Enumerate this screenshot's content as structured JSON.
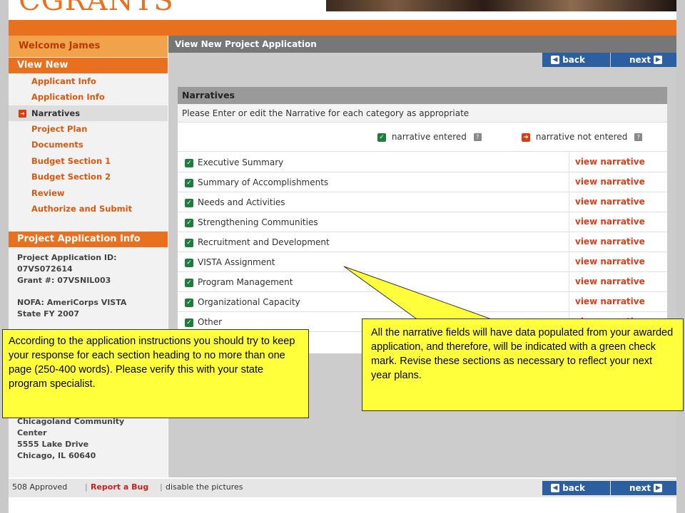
{
  "brand": {
    "logo_text": "CGRANTS",
    "accent": "#e8701f"
  },
  "sidebar": {
    "welcome": "Welcome James",
    "section": "View New",
    "items": [
      {
        "label": "Applicant Info"
      },
      {
        "label": "Application Info"
      },
      {
        "label": "Narratives",
        "active": true
      },
      {
        "label": "Project Plan"
      },
      {
        "label": "Documents"
      },
      {
        "label": "Budget Section 1"
      },
      {
        "label": "Budget Section 2"
      },
      {
        "label": "Review"
      },
      {
        "label": "Authorize and Submit"
      }
    ],
    "info_title": "Project Application Info",
    "info_lines": [
      "Project Application ID:",
      "07VS072614",
      "Grant #: 07VSNIL003",
      "NOFA: AmeriCorps VISTA",
      "State FY 2007"
    ],
    "org_lines": [
      "Chicagoland Community",
      "Center",
      "5555 Lake Drive",
      "Chicago, IL 60640"
    ]
  },
  "main": {
    "title": "View New Project Application",
    "back_label": "back",
    "next_label": "next",
    "narratives": {
      "title": "Narratives",
      "instruction": "Please Enter or edit the Narrative for each category as appropriate",
      "legend_entered": "narrative entered",
      "legend_not_entered": "narrative not entered",
      "link_label": "view narrative",
      "rows": [
        {
          "label": "Executive Summary",
          "status": "entered"
        },
        {
          "label": "Summary of Accomplishments",
          "status": "entered"
        },
        {
          "label": "Needs and Activities",
          "status": "entered"
        },
        {
          "label": "Strengthening Communities",
          "status": "entered"
        },
        {
          "label": "Recruitment and Development",
          "status": "entered"
        },
        {
          "label": "VISTA Assignment",
          "status": "entered"
        },
        {
          "label": "Program Management",
          "status": "entered"
        },
        {
          "label": "Organizational Capacity",
          "status": "entered"
        },
        {
          "label": "Other",
          "status": "entered"
        }
      ]
    }
  },
  "footer": {
    "approved": "508 Approved",
    "report_bug": "Report a Bug",
    "disable_pictures": "disable the pictures",
    "back_label": "back",
    "next_label": "next"
  },
  "callouts": {
    "left": "According to the application instructions you should try to keep your response for each section heading to no more than one page (250-400 words).  Please verify this with your state program specialist.",
    "right": "All the narrative fields will have data populated from your awarded application, and therefore, will be indicated with a green check mark.  Revise these sections as necessary to reflect your next year plans."
  }
}
